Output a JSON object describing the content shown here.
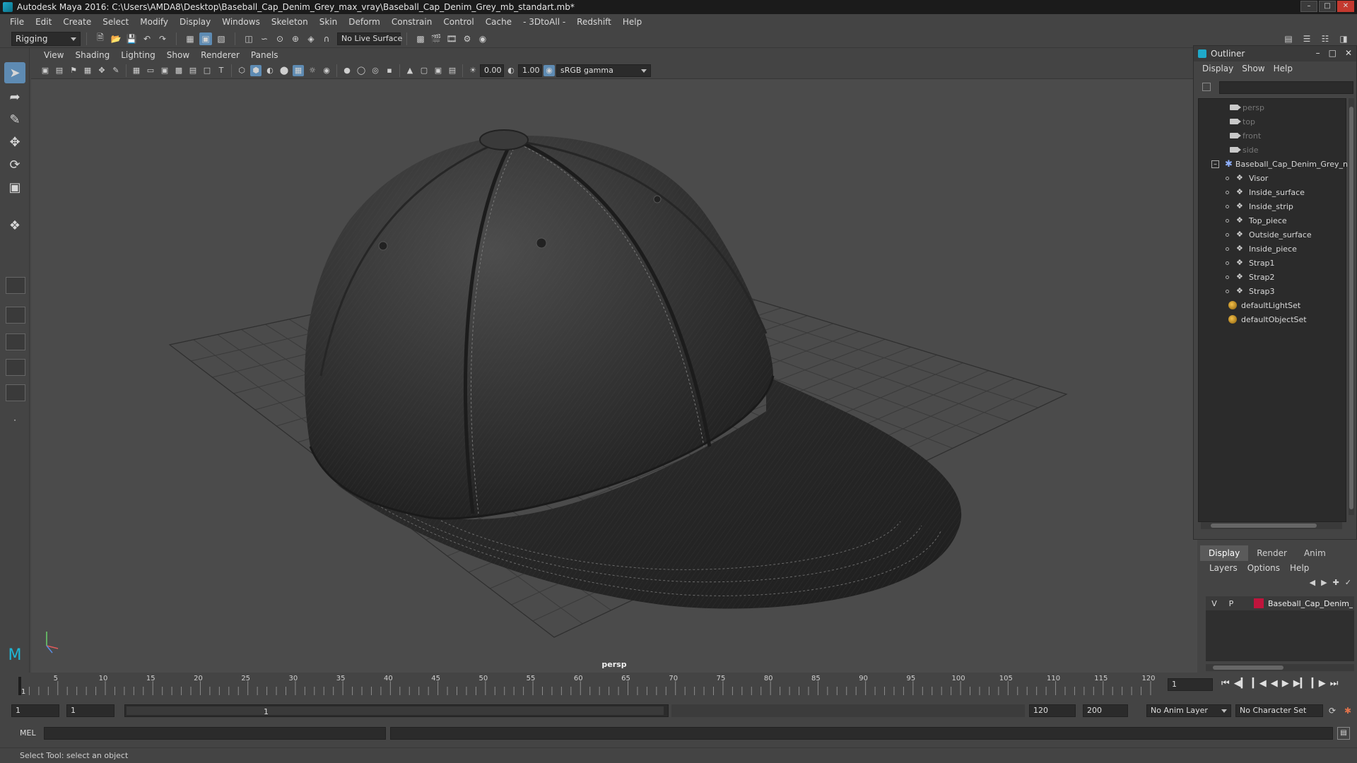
{
  "titlebar": {
    "title": "Autodesk Maya 2016: C:\\Users\\AMDA8\\Desktop\\Baseball_Cap_Denim_Grey_max_vray\\Baseball_Cap_Denim_Grey_mb_standart.mb*"
  },
  "menubar": [
    "File",
    "Edit",
    "Create",
    "Select",
    "Modify",
    "Display",
    "Windows",
    "Skeleton",
    "Skin",
    "Deform",
    "Constrain",
    "Control",
    "Cache",
    "- 3DtoAll -",
    "Redshift",
    "Help"
  ],
  "statusline": {
    "mode": "Rigging",
    "live_surface": "No Live Surface"
  },
  "viewport": {
    "menu": [
      "View",
      "Shading",
      "Lighting",
      "Show",
      "Renderer",
      "Panels"
    ],
    "exposure": "0.00",
    "gamma": "1.00",
    "color_space": "sRGB gamma",
    "camera_label": "persp"
  },
  "outliner": {
    "title": "Outliner",
    "menu": [
      "Display",
      "Show",
      "Help"
    ],
    "cameras": [
      "persp",
      "top",
      "front",
      "side"
    ],
    "root": "Baseball_Cap_Denim_Grey_n",
    "children": [
      "Visor",
      "Inside_surface",
      "Inside_strip",
      "Top_piece",
      "Outside_surface",
      "Inside_piece",
      "Strap1",
      "Strap2",
      "Strap3"
    ],
    "sets": [
      "defaultLightSet",
      "defaultObjectSet"
    ]
  },
  "layers": {
    "tabs": [
      "Display",
      "Render",
      "Anim"
    ],
    "active_tab": "Display",
    "menu": [
      "Layers",
      "Options",
      "Help"
    ],
    "layer": {
      "visible_flag": "V",
      "playback_flag": "P",
      "name": "Baseball_Cap_Denim_G",
      "color": "#c0143c"
    }
  },
  "timeline": {
    "tick_labels": [
      5,
      10,
      15,
      20,
      25,
      30,
      35,
      40,
      45,
      50,
      55,
      60,
      65,
      70,
      75,
      80,
      85,
      90,
      95,
      100,
      105,
      110,
      115,
      120
    ],
    "start_label": "1",
    "current_frame": "1",
    "min": 1,
    "max": 120
  },
  "range": {
    "start_time": "1",
    "playback_start": "1",
    "slider_start": "1",
    "slider_end": "120",
    "playback_end": "120",
    "end_time": "200",
    "anim_layer": "No Anim Layer",
    "character_set": "No Character Set"
  },
  "cmdline": {
    "label": "MEL"
  },
  "helpline": {
    "text": "Select Tool: select an object"
  }
}
